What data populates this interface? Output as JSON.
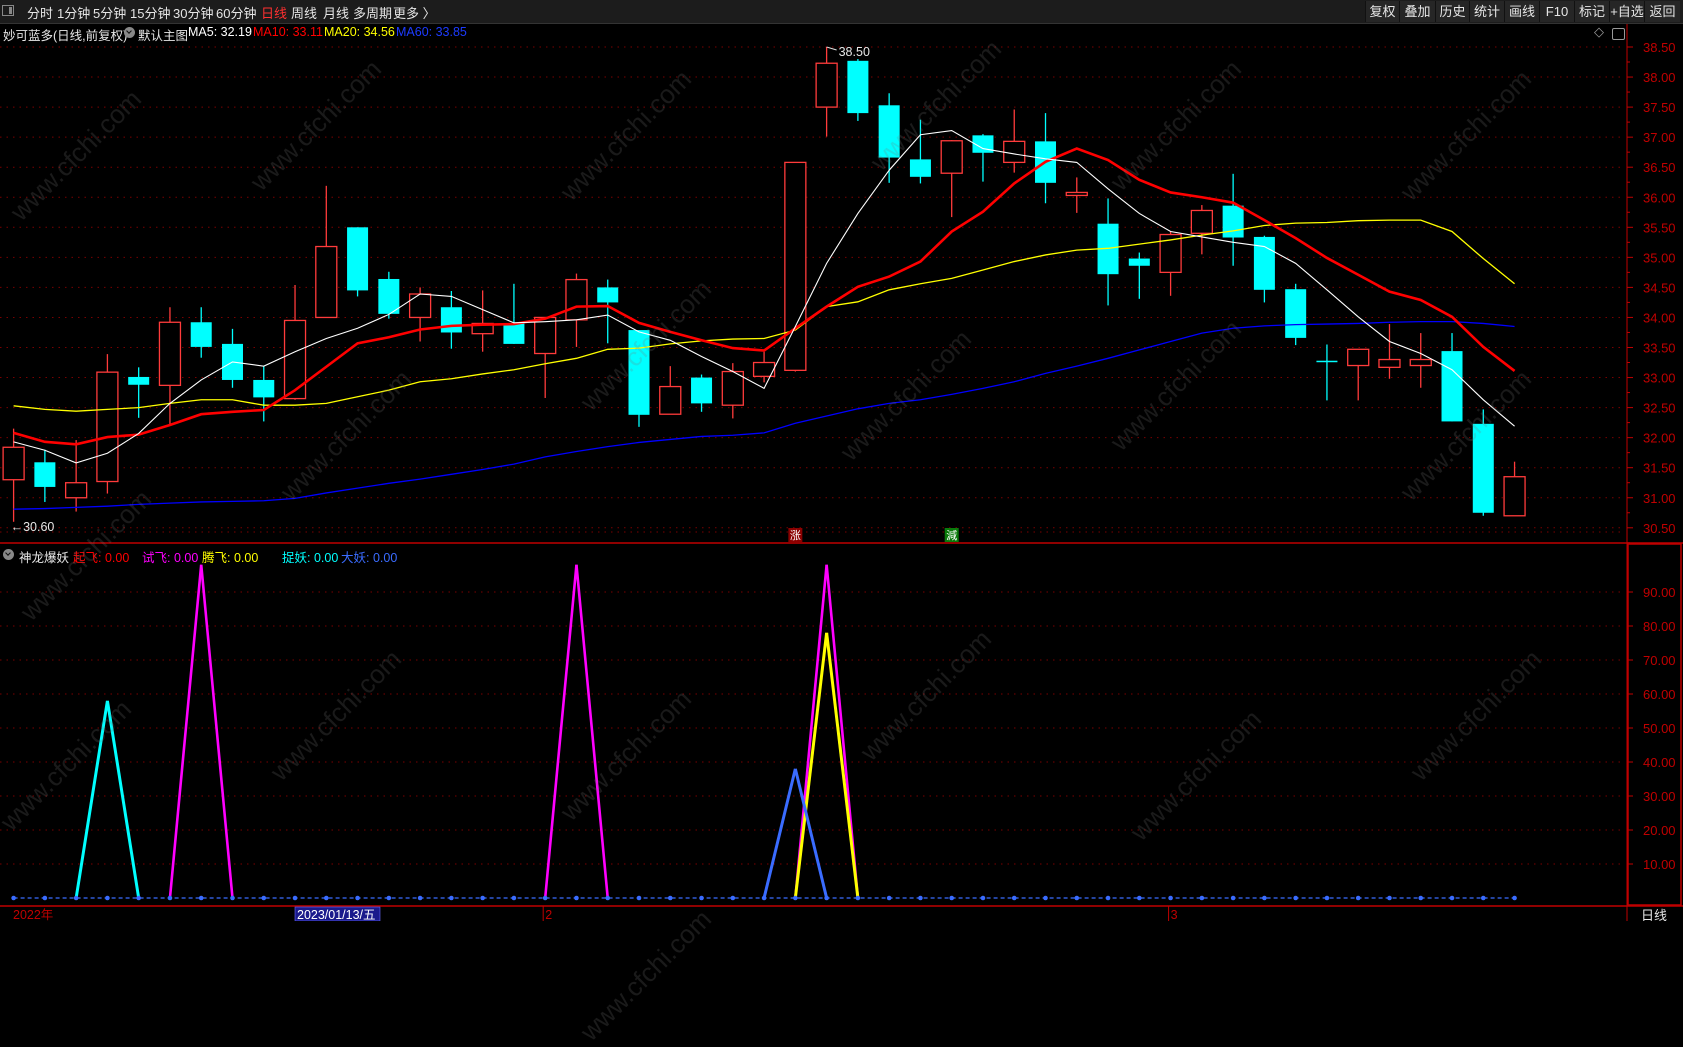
{
  "toolbar": {
    "periods": [
      {
        "label": "分时"
      },
      {
        "label": "1分钟"
      },
      {
        "label": "5分钟"
      },
      {
        "label": "15分钟"
      },
      {
        "label": "30分钟"
      },
      {
        "label": "60分钟"
      },
      {
        "label": "日线",
        "active": true
      },
      {
        "label": "周线"
      },
      {
        "label": "月线"
      },
      {
        "label": "多周期"
      },
      {
        "label": "更多 〉"
      }
    ],
    "actions": [
      {
        "label": "复权"
      },
      {
        "label": "叠加"
      },
      {
        "label": "历史"
      },
      {
        "label": "统计"
      },
      {
        "label": "画线"
      },
      {
        "label": "F10"
      },
      {
        "label": "标记"
      },
      {
        "label": "+自选"
      },
      {
        "label": "返回"
      }
    ]
  },
  "main_legend": {
    "stock": "妙可蓝多(日线,前复权)",
    "template": "默认主图",
    "ma5": "MA5: 32.19",
    "ma10": "MA10: 33.11",
    "ma20": "MA20: 34.56",
    "ma60": "MA60: 33.85"
  },
  "indicator_legend": {
    "name": "神龙爆妖",
    "qifei": "起飞: 0.00",
    "shifei": "试飞: 0.00",
    "tengfei": "腾飞: 0.00",
    "zhuoyao": "捉妖: 0.00",
    "dayao": "大妖: 0.00"
  },
  "colors": {
    "up": "#ff3b3b",
    "down": "#00ffff",
    "ma5": "#ffffff",
    "ma10": "#ff0000",
    "ma20": "#ffff00",
    "ma60": "#0000ff",
    "axis": "#c00000",
    "grid": "#7a0000"
  },
  "watermark": "www.cfchi.com",
  "period_label": "日线",
  "chart_data": {
    "type": "candlestick",
    "price_axis": {
      "ticks": [
        "38.50",
        "38.00",
        "37.50",
        "37.00",
        "36.50",
        "36.00",
        "35.50",
        "35.00",
        "34.50",
        "34.00",
        "33.50",
        "33.00",
        "32.50",
        "32.00",
        "31.50",
        "31.00",
        "30.50"
      ],
      "range": [
        30.5,
        38.5
      ]
    },
    "high_label": "38.50",
    "low_label": "30.60",
    "candles": [
      [
        31.3,
        32.15,
        30.6,
        31.84
      ],
      [
        31.59,
        31.8,
        30.93,
        31.18
      ],
      [
        31.0,
        31.96,
        30.77,
        31.25
      ],
      [
        31.27,
        33.39,
        31.07,
        33.09
      ],
      [
        33.01,
        33.17,
        32.33,
        32.88
      ],
      [
        32.87,
        34.17,
        32.21,
        33.92
      ],
      [
        33.92,
        34.17,
        33.33,
        33.51
      ],
      [
        33.56,
        33.81,
        32.83,
        32.96
      ],
      [
        32.96,
        33.2,
        32.27,
        32.67
      ],
      [
        32.65,
        34.54,
        32.63,
        33.95
      ],
      [
        34.0,
        36.19,
        34.0,
        35.18
      ],
      [
        35.5,
        35.5,
        34.35,
        34.45
      ],
      [
        34.64,
        34.76,
        33.98,
        34.06
      ],
      [
        34.0,
        34.5,
        33.6,
        34.39
      ],
      [
        34.17,
        34.44,
        33.48,
        33.75
      ],
      [
        33.73,
        34.45,
        33.43,
        33.9
      ],
      [
        33.9,
        34.56,
        33.56,
        33.56
      ],
      [
        33.4,
        34.0,
        32.66,
        34.0
      ],
      [
        33.96,
        34.73,
        33.51,
        34.63
      ],
      [
        34.5,
        34.63,
        33.57,
        34.25
      ],
      [
        33.79,
        33.79,
        32.18,
        32.38
      ],
      [
        32.39,
        33.19,
        32.39,
        32.85
      ],
      [
        33.0,
        33.05,
        32.43,
        32.57
      ],
      [
        32.54,
        33.24,
        32.32,
        33.1
      ],
      [
        33.02,
        33.43,
        32.92,
        33.25
      ],
      [
        33.12,
        36.58,
        33.1,
        36.58
      ],
      [
        37.5,
        38.5,
        37.01,
        38.23
      ],
      [
        38.27,
        38.3,
        37.27,
        37.4
      ],
      [
        37.53,
        37.73,
        36.24,
        36.66
      ],
      [
        36.63,
        37.29,
        36.23,
        36.34
      ],
      [
        36.4,
        36.95,
        35.67,
        36.94
      ],
      [
        37.03,
        37.05,
        36.26,
        36.74
      ],
      [
        36.58,
        37.46,
        36.41,
        36.93
      ],
      [
        36.93,
        37.4,
        35.9,
        36.24
      ],
      [
        36.03,
        36.33,
        35.74,
        36.08
      ],
      [
        35.56,
        35.98,
        34.2,
        34.72
      ],
      [
        34.98,
        35.08,
        34.31,
        34.86
      ],
      [
        34.75,
        35.43,
        34.36,
        35.38
      ],
      [
        35.4,
        35.87,
        35.05,
        35.78
      ],
      [
        35.86,
        36.39,
        34.86,
        35.33
      ],
      [
        35.34,
        35.36,
        34.25,
        34.46
      ],
      [
        34.47,
        34.56,
        33.54,
        33.66
      ],
      [
        33.28,
        33.55,
        32.62,
        33.26
      ],
      [
        33.2,
        33.47,
        32.62,
        33.47
      ],
      [
        33.17,
        33.89,
        32.98,
        33.3
      ],
      [
        33.2,
        33.74,
        32.83,
        33.3
      ],
      [
        33.44,
        33.74,
        32.27,
        32.27
      ],
      [
        32.23,
        32.47,
        30.7,
        30.75
      ],
      [
        30.7,
        31.6,
        30.7,
        31.35
      ]
    ],
    "ma5": [
      31.93,
      31.79,
      31.58,
      31.74,
      32.07,
      32.57,
      32.96,
      33.26,
      33.19,
      33.43,
      33.65,
      33.82,
      34.05,
      34.39,
      34.35,
      34.13,
      33.91,
      33.93,
      33.96,
      34.04,
      33.76,
      33.62,
      33.35,
      33.1,
      32.82,
      33.85,
      34.9,
      35.73,
      36.45,
      37.04,
      37.11,
      36.81,
      36.72,
      36.64,
      36.58,
      36.14,
      35.73,
      35.43,
      35.34,
      35.25,
      35.18,
      34.9,
      34.46,
      34.01,
      33.6,
      33.4,
      33.13,
      32.63,
      32.19
    ],
    "ma10": [
      32.08,
      31.93,
      31.89,
      32.01,
      32.05,
      32.21,
      32.39,
      32.43,
      32.46,
      32.79,
      33.18,
      33.57,
      33.67,
      33.8,
      33.86,
      33.88,
      33.89,
      33.98,
      34.18,
      34.19,
      33.91,
      33.76,
      33.62,
      33.49,
      33.45,
      33.82,
      34.18,
      34.51,
      34.68,
      34.93,
      35.43,
      35.76,
      36.23,
      36.59,
      36.81,
      36.62,
      36.29,
      36.08,
      36.0,
      35.91,
      35.62,
      35.32,
      34.99,
      34.71,
      34.43,
      34.29,
      34.01,
      33.51,
      33.11
    ],
    "ma20": [
      32.53,
      32.47,
      32.44,
      32.47,
      32.5,
      32.57,
      32.63,
      32.63,
      32.54,
      32.54,
      32.57,
      32.68,
      32.79,
      32.93,
      32.98,
      33.06,
      33.13,
      33.23,
      33.32,
      33.47,
      33.49,
      33.56,
      33.61,
      33.64,
      33.65,
      33.79,
      34.18,
      34.26,
      34.46,
      34.56,
      34.65,
      34.79,
      34.93,
      35.04,
      35.12,
      35.15,
      35.22,
      35.29,
      35.37,
      35.44,
      35.53,
      35.57,
      35.58,
      35.61,
      35.62,
      35.62,
      35.43,
      34.98,
      34.56
    ],
    "ma60": [
      30.81,
      30.82,
      30.84,
      30.86,
      30.89,
      30.91,
      30.93,
      30.94,
      30.95,
      30.99,
      31.08,
      31.16,
      31.24,
      31.31,
      31.39,
      31.47,
      31.56,
      31.68,
      31.77,
      31.85,
      31.92,
      31.97,
      32.02,
      32.04,
      32.08,
      32.24,
      32.36,
      32.48,
      32.57,
      32.63,
      32.72,
      32.82,
      32.93,
      33.07,
      33.19,
      33.32,
      33.46,
      33.6,
      33.74,
      33.82,
      33.86,
      33.88,
      33.89,
      33.9,
      33.92,
      33.93,
      33.93,
      33.9,
      33.85
    ],
    "signals": [
      {
        "index": 25,
        "text": "涨",
        "color": "#8b0000"
      },
      {
        "index": 30,
        "text": "減",
        "color": "#0a7a0a"
      }
    ],
    "indicator": {
      "axis_ticks": [
        "90.00",
        "80.00",
        "70.00",
        "60.00",
        "50.00",
        "40.00",
        "30.00",
        "20.00",
        "10.00"
      ],
      "range": [
        0,
        100
      ],
      "series": [
        {
          "name": "起飞",
          "color": "#ff0000",
          "points": {}
        },
        {
          "name": "试飞",
          "color": "#ff00ff",
          "points": {
            "6": 98,
            "18": 98,
            "26": 98
          }
        },
        {
          "name": "腾飞",
          "color": "#ffff00",
          "points": {
            "26": 78
          }
        },
        {
          "name": "捉妖",
          "color": "#00ffff",
          "points": {
            "3": 58
          }
        },
        {
          "name": "大妖",
          "color": "#3a6cff",
          "points": {
            "25": 38
          },
          "baseline_markers": true
        }
      ]
    },
    "time_axis": [
      {
        "label": "2022年",
        "index": 0
      },
      {
        "label": "2023/01/13/五",
        "index": 9,
        "highlight": true
      },
      {
        "label": "2",
        "index": 17
      },
      {
        "label": "3",
        "index": 37
      }
    ]
  }
}
